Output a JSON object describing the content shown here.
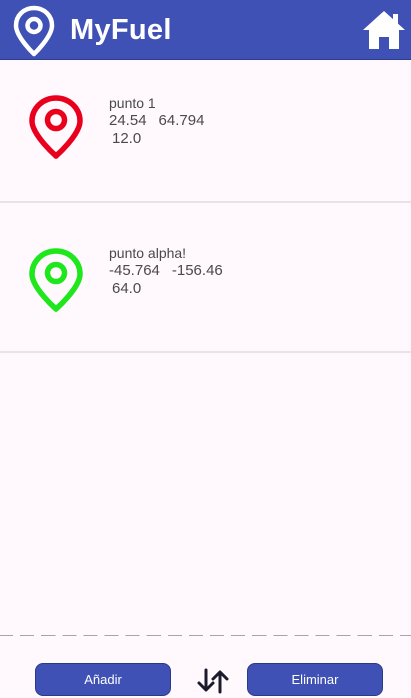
{
  "app_bar": {
    "title": "MyFuel",
    "logo_icon": "location-pin-icon",
    "home_icon": "home-icon",
    "color": "#3f51b5"
  },
  "points": [
    {
      "name": "punto 1",
      "lat": "24.54",
      "lon": "64.794",
      "value": "12.0",
      "pin_color": "#e8001c"
    },
    {
      "name": "punto alpha!",
      "lat": "-45.764",
      "lon": "-156.46",
      "value": "64.0",
      "pin_color": "#1ee81b"
    }
  ],
  "actions": {
    "add_label": "Añadir",
    "delete_label": "Eliminar",
    "sort_icon": "sort-arrows-icon"
  }
}
